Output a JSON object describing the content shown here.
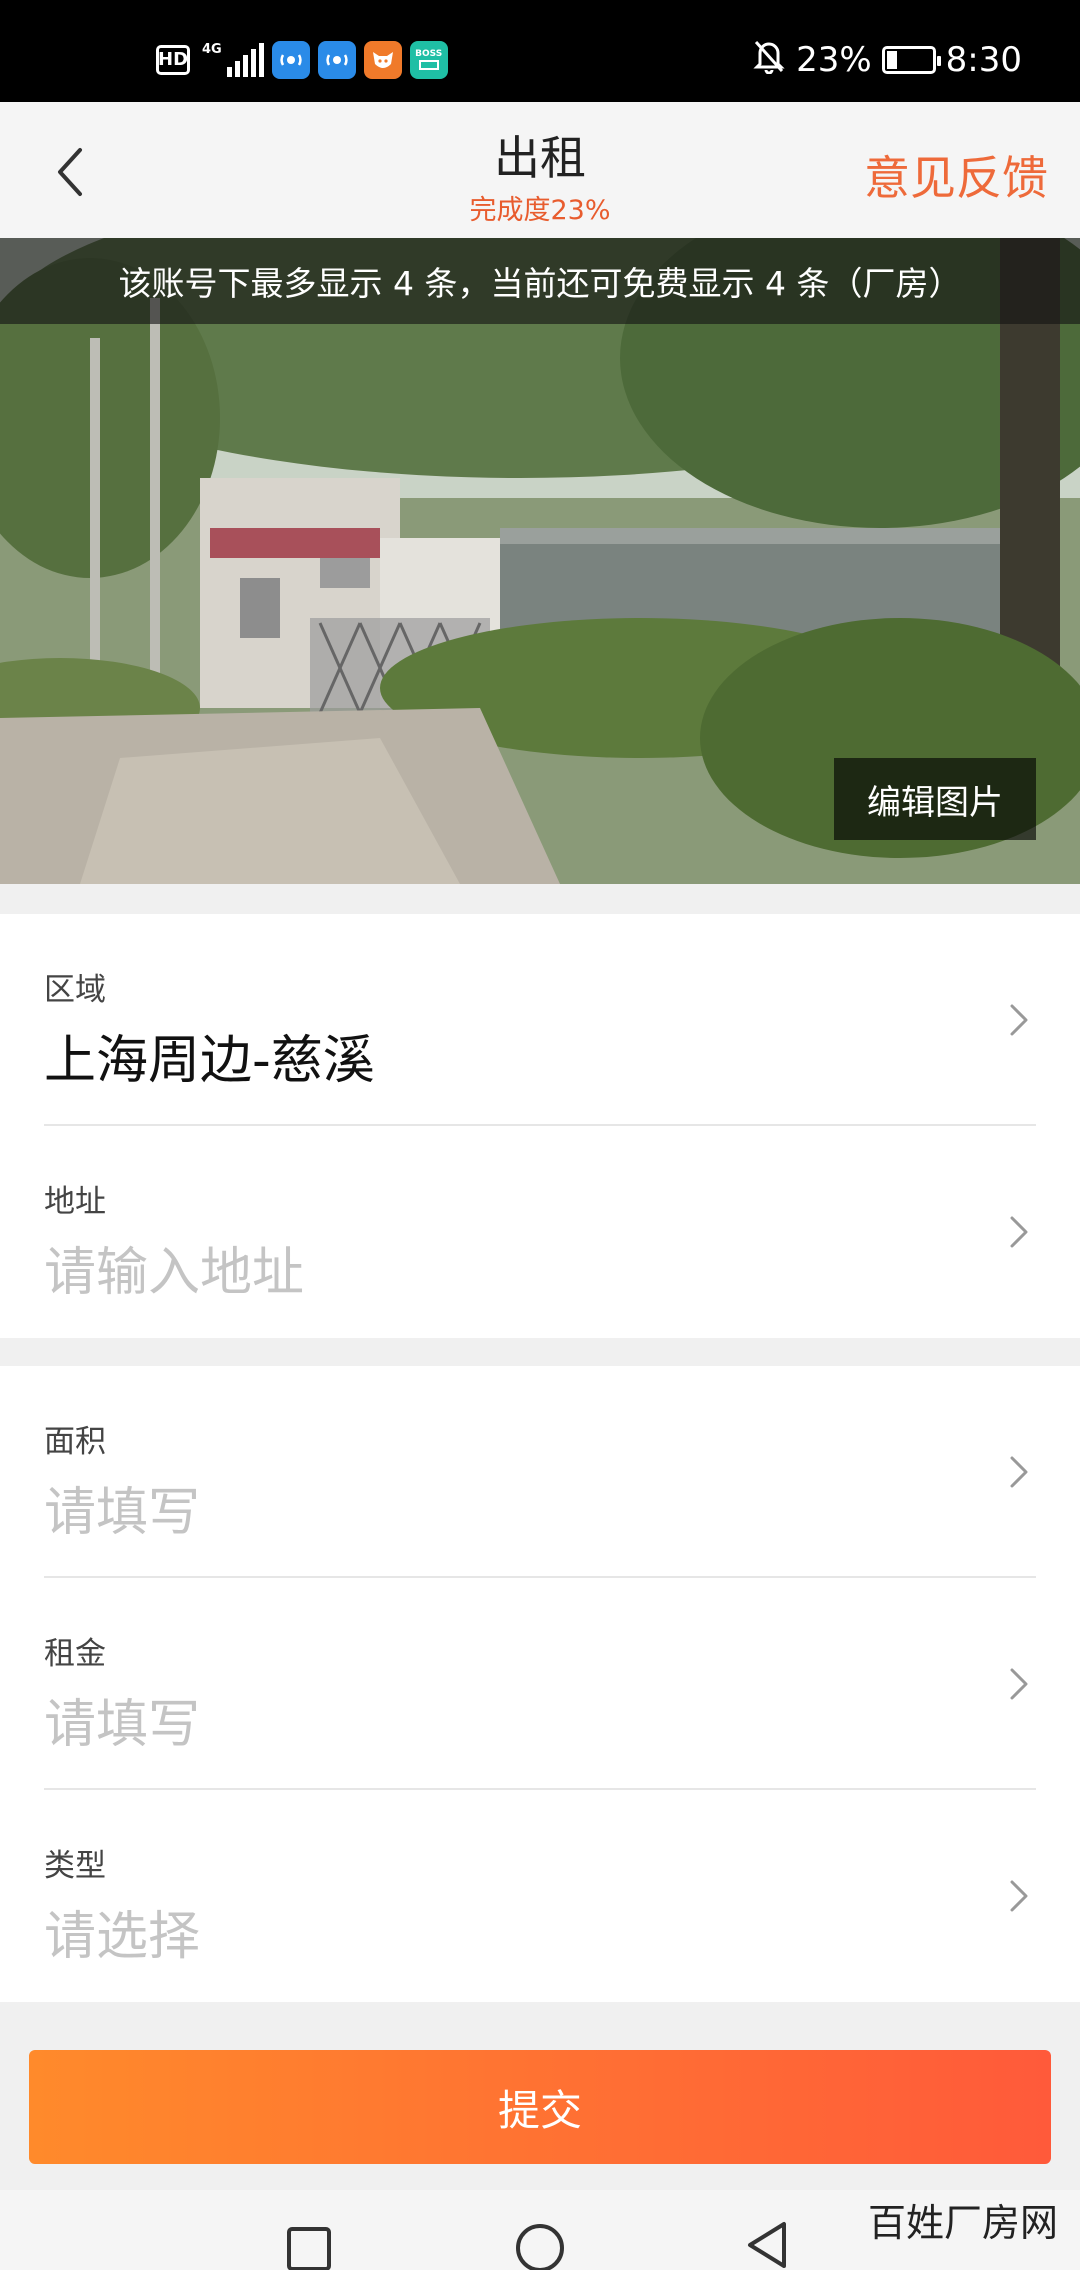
{
  "status_bar": {
    "left_icons": [
      "hd-icon",
      "4g-signal-icon",
      "app-icon-blue-1",
      "app-icon-blue-2",
      "app-icon-orange",
      "app-icon-boss"
    ],
    "hd_label": "HD",
    "network_label": "4G",
    "boss_label": "BOSS",
    "battery_percent": "23%",
    "battery_level": 0.23,
    "time": "8:30",
    "mute_icon": "bell-off-icon"
  },
  "header": {
    "back_icon": "chevron-left-icon",
    "title": "出租",
    "subtitle": "完成度23%",
    "feedback_label": "意见反馈"
  },
  "photo": {
    "notice": "该账号下最多显示 4 条，当前还可免费显示 4 条（厂房）",
    "edit_label": "编辑图片"
  },
  "form": {
    "section1": [
      {
        "label": "区域",
        "value": "上海周边-慈溪",
        "is_placeholder": false
      },
      {
        "label": "地址",
        "value": "请输入地址",
        "is_placeholder": true
      }
    ],
    "section2": [
      {
        "label": "面积",
        "value": "请填写",
        "is_placeholder": true
      },
      {
        "label": "租金",
        "value": "请填写",
        "is_placeholder": true
      },
      {
        "label": "类型",
        "value": "请选择",
        "is_placeholder": true
      }
    ]
  },
  "submit_label": "提交",
  "nav": {
    "icons": [
      "square-icon",
      "circle-icon",
      "triangle-back-icon"
    ]
  },
  "watermark": "百姓厂房网",
  "colors": {
    "accent": "#ee6a3a",
    "subtitle": "#e85c2e",
    "button_start": "#ff8a2b",
    "button_end": "#ff5a3a",
    "placeholder": "#c4c4c4"
  }
}
